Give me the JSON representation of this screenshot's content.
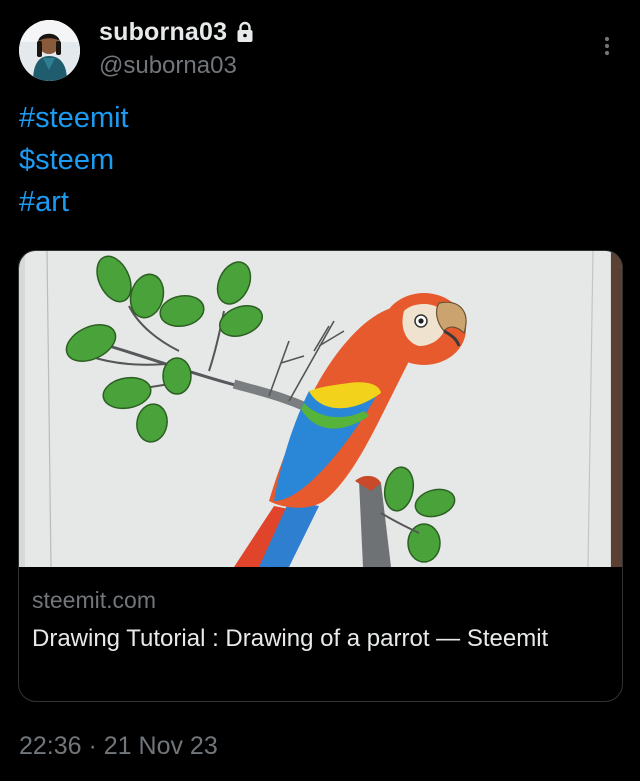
{
  "author": {
    "display_name": "suborna03",
    "handle": "@suborna03",
    "protected_icon": "lock-icon"
  },
  "menu": {
    "more_icon": "more-vertical-icon"
  },
  "post": {
    "tags": [
      "#steemit",
      "$steem",
      "#art"
    ]
  },
  "link_card": {
    "image": "hand-drawn colored pencil parrot on branch with green leaves",
    "domain": "steemit.com",
    "title": "Drawing Tutorial : Drawing of a parrot — Steemit"
  },
  "meta": {
    "timestamp": "22:36 · 21 Nov 23"
  },
  "colors": {
    "background": "#000000",
    "text_primary": "#e7e9ea",
    "text_secondary": "#71767b",
    "link": "#1d9bf0",
    "card_border": "#2f3336"
  }
}
